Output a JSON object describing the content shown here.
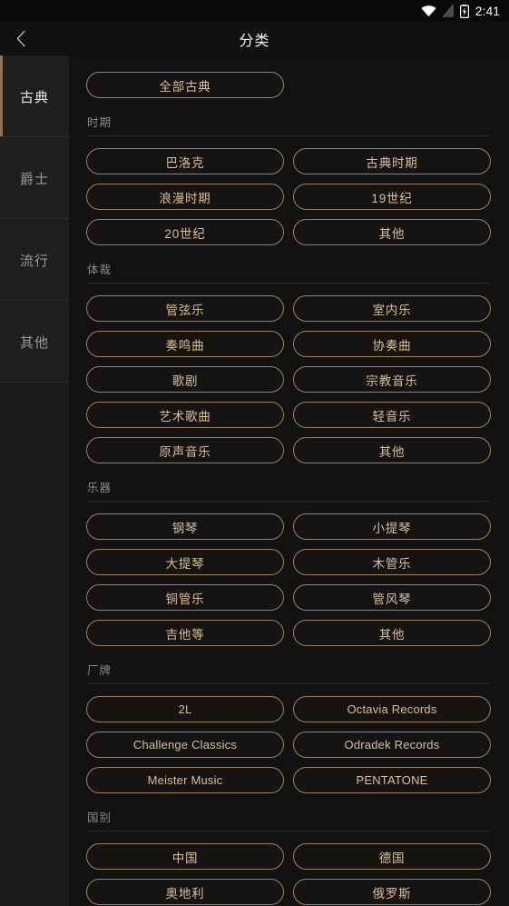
{
  "status_bar": {
    "clock": "2:41",
    "icons": [
      "wifi-icon",
      "signal-off-icon",
      "battery-charging-icon"
    ]
  },
  "app_bar": {
    "back_icon": "chevron-left-icon",
    "title": "分类"
  },
  "colors": {
    "background": "#121212",
    "sidebar_background": "#1e1e1e",
    "accent": "#8b7355",
    "chip_border": "#9b8258",
    "chip_text": "#d9bf9a",
    "chip_fill": "#161412",
    "section_label": "#8a8a8a",
    "title_text": "#f2f2f2"
  },
  "sidebar": {
    "items": [
      {
        "label": "古典",
        "active": true
      },
      {
        "label": "爵士",
        "active": false
      },
      {
        "label": "流行",
        "active": false
      },
      {
        "label": "其他",
        "active": false
      }
    ]
  },
  "main": {
    "top_chip": {
      "label": "全部古典"
    },
    "sections": [
      {
        "label": "时期",
        "chips": [
          "巴洛克",
          "古典时期",
          "浪漫时期",
          "19世纪",
          "20世纪",
          "其他"
        ]
      },
      {
        "label": "体裁",
        "chips": [
          "管弦乐",
          "室内乐",
          "奏鸣曲",
          "协奏曲",
          "歌剧",
          "宗教音乐",
          "艺术歌曲",
          "轻音乐",
          "原声音乐",
          "其他"
        ]
      },
      {
        "label": "乐器",
        "chips": [
          "钢琴",
          "小提琴",
          "大提琴",
          "木管乐",
          "铜管乐",
          "管风琴",
          "吉他等",
          "其他"
        ]
      },
      {
        "label": "厂牌",
        "chips": [
          "2L",
          "Octavia Records",
          "Challenge Classics",
          "Odradek Records",
          "Meister Music",
          "PENTATONE"
        ]
      },
      {
        "label": "国别",
        "chips": [
          "中国",
          "德国",
          "奥地利",
          "俄罗斯"
        ]
      }
    ]
  }
}
